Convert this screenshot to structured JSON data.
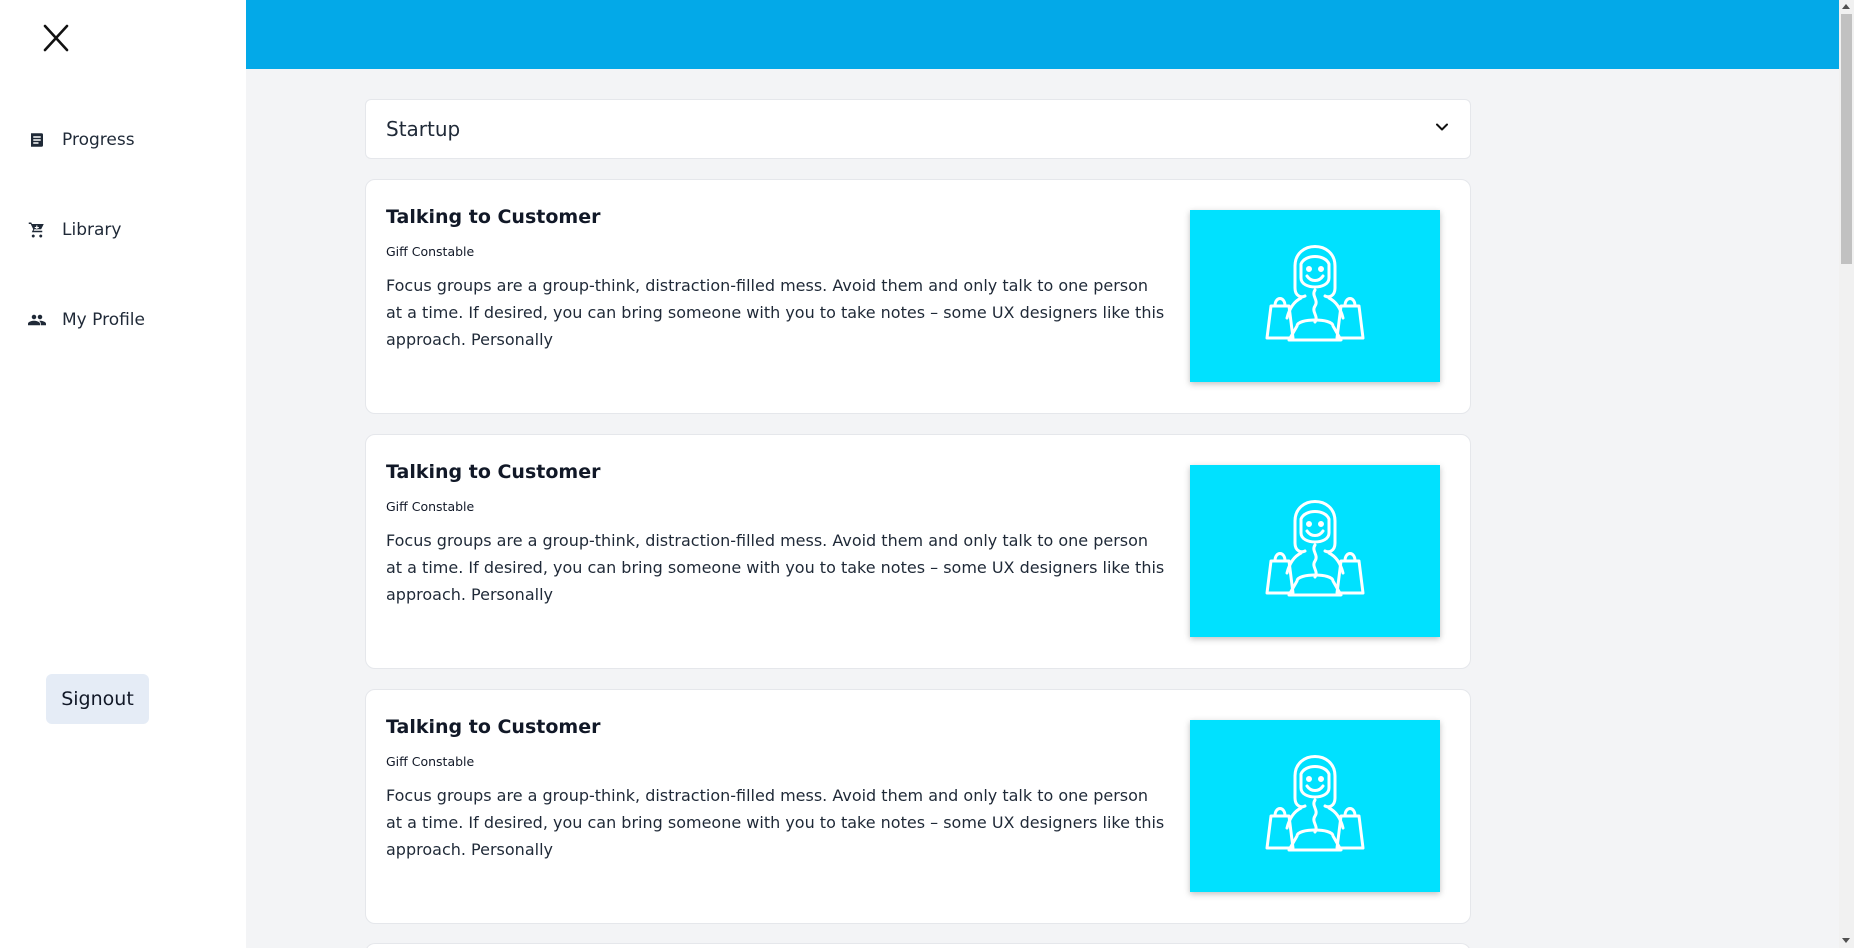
{
  "sidebar": {
    "items": [
      {
        "label": "Progress",
        "icon": "clipboard-icon"
      },
      {
        "label": "Library",
        "icon": "cart-icon"
      },
      {
        "label": "My Profile",
        "icon": "people-icon"
      }
    ],
    "signout_label": "Signout"
  },
  "colors": {
    "topbar": "#03a9e8",
    "thumbnail": "#00e1ff"
  },
  "filter": {
    "selected": "Startup"
  },
  "cards": [
    {
      "title": "Talking to Customer",
      "author": "Giff Constable",
      "description": "Focus groups are a group-think, distraction-filled mess. Avoid them and only talk to one person at a time. If desired, you can bring someone with you to take notes – some UX designers like this approach. Personally",
      "thumbnail_icon": "shopper-icon"
    },
    {
      "title": "Talking to Customer",
      "author": "Giff Constable",
      "description": "Focus groups are a group-think, distraction-filled mess. Avoid them and only talk to one person at a time. If desired, you can bring someone with you to take notes – some UX designers like this approach. Personally",
      "thumbnail_icon": "shopper-icon"
    },
    {
      "title": "Talking to Customer",
      "author": "Giff Constable",
      "description": "Focus groups are a group-think, distraction-filled mess. Avoid them and only talk to one person at a time. If desired, you can bring someone with you to take notes – some UX designers like this approach. Personally",
      "thumbnail_icon": "shopper-icon"
    }
  ]
}
